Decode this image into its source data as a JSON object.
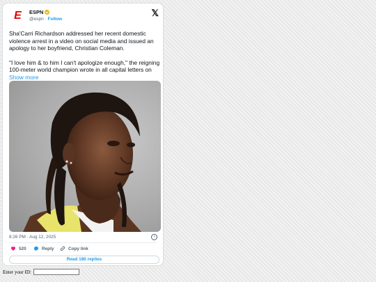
{
  "tweet": {
    "author_name": "ESPN",
    "handle": "@espn",
    "separator": "·",
    "follow_label": "Follow",
    "logo_text": "E",
    "paragraph1": "Sha'Carri Richardson addressed her recent domestic violence arrest in a video on social media and issued an apology to her boyfriend, Christian Coleman.",
    "paragraph2": "\"I love him & to him I can't apologize enough,\" the reigning 100-meter world champion wrote in all capital letters on ",
    "show_more": "Show more",
    "timestamp": "8:26 PM · Aug 12, 2025",
    "likes": "520",
    "reply_label": "Reply",
    "copy_link_label": "Copy link",
    "read_replies_label": "Read 180 replies",
    "accent_color": "#1d9bf0",
    "like_color": "#f91880"
  },
  "form": {
    "id_label": "Enter your ID:",
    "id_value": ""
  }
}
